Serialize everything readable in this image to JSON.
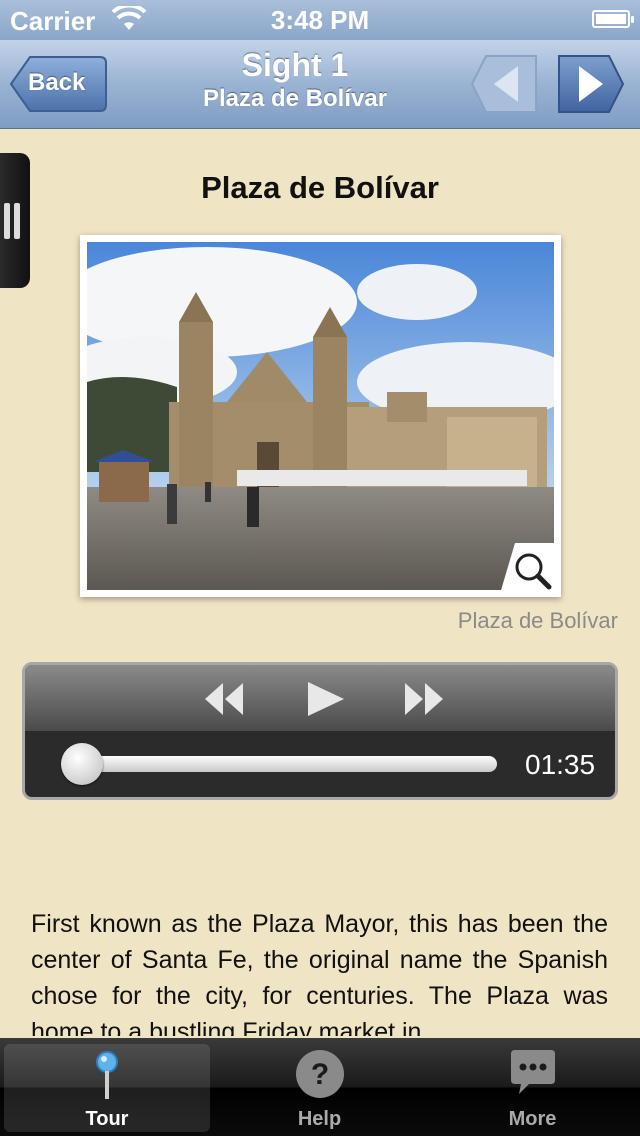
{
  "status_bar": {
    "carrier": "Carrier",
    "time": "3:48 PM"
  },
  "nav": {
    "back_label": "Back",
    "title": "Sight 1",
    "subtitle": "Plaza de Bolívar",
    "prev_icon": "triangle-left-icon",
    "next_icon": "triangle-right-icon"
  },
  "sight": {
    "heading": "Plaza de Bolívar",
    "photo_caption": "Plaza de Bolívar"
  },
  "player": {
    "elapsed_fraction": 0.0,
    "time": "01:35"
  },
  "description": "First known as the Plaza Mayor, this has been the center of Santa Fe, the original name the Spanish chose for the city, for centuries. The Plaza was home to a bustling Friday market in",
  "tabs": [
    {
      "label": "Tour",
      "icon": "pin-icon",
      "active": true
    },
    {
      "label": "Help",
      "icon": "question-icon",
      "active": false
    },
    {
      "label": "More",
      "icon": "speech-bubble-icon",
      "active": false
    }
  ],
  "colors": {
    "nav_blue": "#8aa6c9",
    "page_bg": "#efe4c4",
    "tab_bar": "#1a1a1a"
  }
}
